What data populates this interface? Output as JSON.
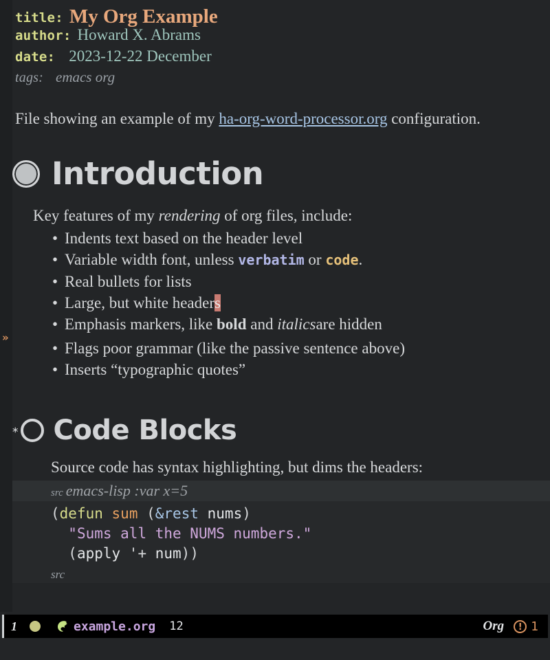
{
  "document": {
    "keywords": [
      {
        "key": "title:",
        "value": "My Org Example"
      },
      {
        "key": "author:",
        "value": "Howard X. Abrams"
      },
      {
        "key": "date:",
        "value": "2023-12-22 December"
      },
      {
        "key": "tags:",
        "value": "emacs org"
      }
    ],
    "intro": {
      "before": "File showing an example of my ",
      "link": "ha-org-word-processor.org",
      "after": " configuration."
    },
    "sections": [
      {
        "heading": "Introduction",
        "lead": {
          "before": "Key features of my ",
          "emphasis": "rendering",
          "after": " of org files, include:"
        },
        "items": [
          {
            "text": "Indents text based on the header level"
          },
          {
            "before": "Variable width font, unless ",
            "verbatim": "verbatim",
            "middle": " or ",
            "code": "code",
            "after": "."
          },
          {
            "text": "Real bullets for lists"
          },
          {
            "before": "Large, but white header",
            "cursor": "s"
          },
          {
            "before": "Emphasis markers, like ",
            "bold": "bold",
            "middle": " and ",
            "italic": "italics",
            "after": "are hidden"
          },
          {
            "text": "Flags poor grammar (like the passive sentence above)"
          },
          {
            "text": "Inserts “typographic quotes”"
          }
        ]
      },
      {
        "heading": "Code Blocks",
        "stars": "*",
        "lead_text": "Source code has syntax highlighting, but dims the headers:",
        "src_block": {
          "begin_keyword": "src",
          "begin_args": "emacs-lisp :var x=5",
          "end_keyword": "src",
          "lines": [
            [
              {
                "t": "(",
                "c": "paren"
              },
              {
                "t": "defun",
                "c": "defun"
              },
              {
                "t": " ",
                "c": "paren"
              },
              {
                "t": "sum",
                "c": "fname"
              },
              {
                "t": " (",
                "c": "paren"
              },
              {
                "t": "&rest",
                "c": "amp"
              },
              {
                "t": " ",
                "c": "paren"
              },
              {
                "t": "nums",
                "c": "var"
              },
              {
                "t": ")",
                "c": "paren"
              }
            ],
            [
              {
                "t": "  ",
                "c": "paren"
              },
              {
                "t": "\"Sums all the NUMS numbers.\"",
                "c": "str"
              }
            ],
            [
              {
                "t": "  (",
                "c": "paren"
              },
              {
                "t": "apply",
                "c": "var"
              },
              {
                "t": " '+ ",
                "c": "paren"
              },
              {
                "t": "num",
                "c": "var"
              },
              {
                "t": "))",
                "c": "paren"
              }
            ]
          ]
        }
      }
    ],
    "fringe_marker": "»"
  },
  "modeline": {
    "window_number": "1",
    "buffer_name": "example.org",
    "line_number": "12",
    "major_mode": "Org",
    "warning_glyph": "!",
    "warning_count": "1"
  }
}
